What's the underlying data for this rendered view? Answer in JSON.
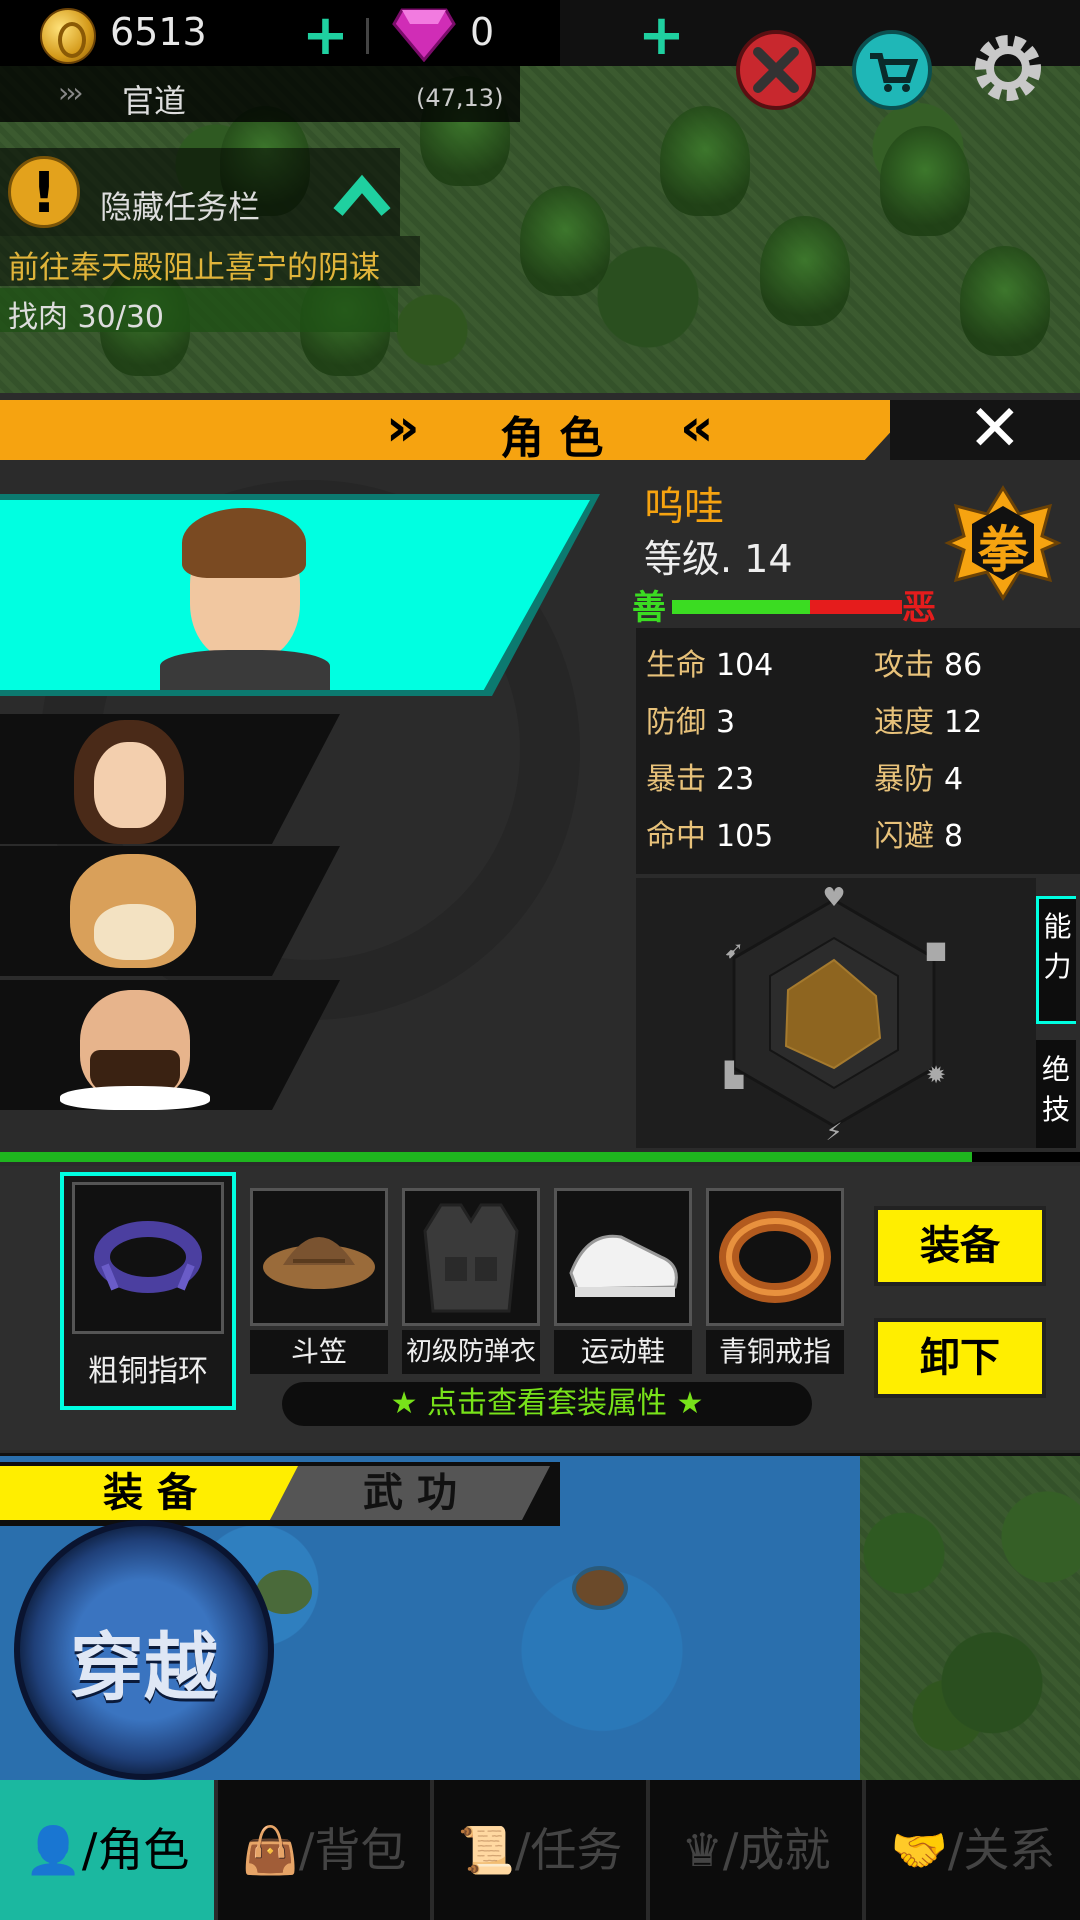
{
  "hud": {
    "coins": "6513",
    "gems": "0",
    "location": "官道",
    "coords": "(47,13)"
  },
  "quest": {
    "toggle_label": "隐藏任务栏",
    "main_quest": "前往奉天殿阻止喜宁的阴谋",
    "sub_quest": "找肉 30/30"
  },
  "panel": {
    "title": "角 色",
    "title_left_arrows": "»",
    "title_right_arrows": "«",
    "close_glyph": "✕"
  },
  "character": {
    "name": "呜哇",
    "level": "等级. 14",
    "style_badge": "拳",
    "good_label": "善",
    "evil_label": "恶",
    "morality_good_fraction": 0.6
  },
  "stats": [
    {
      "label": "生命",
      "value": "104"
    },
    {
      "label": "攻击",
      "value": "86"
    },
    {
      "label": "防御",
      "value": "3"
    },
    {
      "label": "速度",
      "value": "12"
    },
    {
      "label": "暴击",
      "value": "23"
    },
    {
      "label": "暴防",
      "value": "4"
    },
    {
      "label": "命中",
      "value": "105"
    },
    {
      "label": "闪避",
      "value": "8"
    }
  ],
  "side_tabs": {
    "ability": "能力",
    "skill": "绝技"
  },
  "equipment": {
    "items": [
      {
        "name": "粗铜指环"
      },
      {
        "name": "斗笠"
      },
      {
        "name": "初级防弹衣"
      },
      {
        "name": "运动鞋"
      },
      {
        "name": "青铜戒指"
      }
    ],
    "equip_button": "装备",
    "unequip_button": "卸下",
    "set_hint": "★ 点击查看套装属性 ★",
    "experience_fraction": 0.9
  },
  "bottom_tabs": {
    "equip": "装 备",
    "martial": "武 功"
  },
  "travel_button": "穿越",
  "nav": [
    {
      "label": "/角色"
    },
    {
      "label": "/背包"
    },
    {
      "label": "/任务"
    },
    {
      "label": "/成就"
    },
    {
      "label": "/关系"
    }
  ],
  "colors": {
    "accent_orange": "#f6a310",
    "selected_cyan": "#00ffe1",
    "button_yellow": "#ffee00",
    "good_green": "#3bdc22",
    "evil_red": "#e51c1c",
    "hint_green": "#78e21a"
  }
}
